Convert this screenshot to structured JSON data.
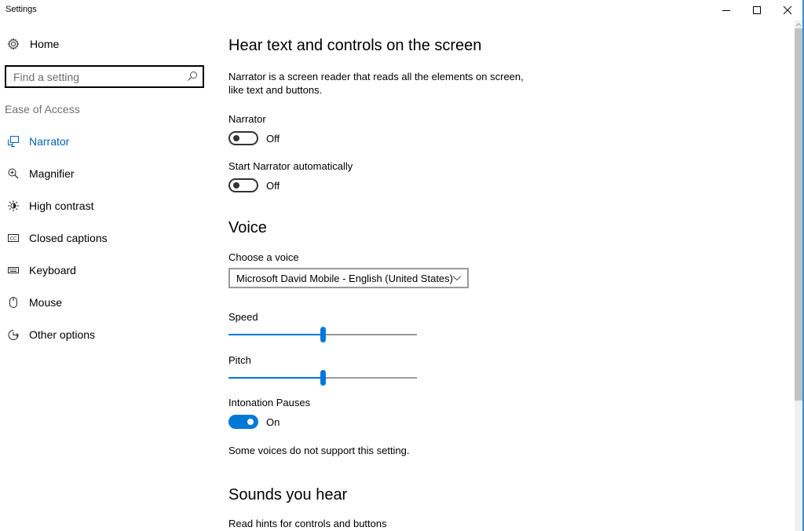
{
  "window": {
    "title": "Settings",
    "controls": {
      "minimize": "minimize",
      "maximize": "maximize",
      "close": "close"
    }
  },
  "sidebar": {
    "home_label": "Home",
    "search": {
      "placeholder": "Find a setting",
      "value": ""
    },
    "section_label": "Ease of Access",
    "active_item": "Narrator",
    "items": [
      {
        "label": "Narrator",
        "icon": "narrator-icon"
      },
      {
        "label": "Magnifier",
        "icon": "magnifier-icon"
      },
      {
        "label": "High contrast",
        "icon": "high-contrast-icon"
      },
      {
        "label": "Closed captions",
        "icon": "closed-captions-icon"
      },
      {
        "label": "Keyboard",
        "icon": "keyboard-icon"
      },
      {
        "label": "Mouse",
        "icon": "mouse-icon"
      },
      {
        "label": "Other options",
        "icon": "other-options-icon"
      }
    ]
  },
  "main": {
    "heading": "Hear text and controls on the screen",
    "description_line1": "Narrator is a screen reader that reads all the elements on screen,",
    "description_line2": "like text and buttons.",
    "narrator": {
      "label": "Narrator",
      "state": "Off",
      "on": false
    },
    "start_auto": {
      "label": "Start Narrator automatically",
      "state": "Off",
      "on": false
    },
    "voice_section": {
      "heading": "Voice",
      "choose_label": "Choose a voice",
      "selected_voice": "Microsoft David Mobile - English (United States)",
      "speed": {
        "label": "Speed",
        "value_percent": 50
      },
      "pitch": {
        "label": "Pitch",
        "value_percent": 50
      },
      "intonation": {
        "label": "Intonation Pauses",
        "state": "On",
        "on": true
      },
      "note": "Some voices do not support this setting."
    },
    "sounds_section": {
      "heading": "Sounds you hear",
      "read_hints_label": "Read hints for controls and buttons"
    }
  },
  "scrollbar": {
    "position_percent": 0
  },
  "colors": {
    "accent": "#0078d7",
    "active_nav": "#0063b1"
  }
}
